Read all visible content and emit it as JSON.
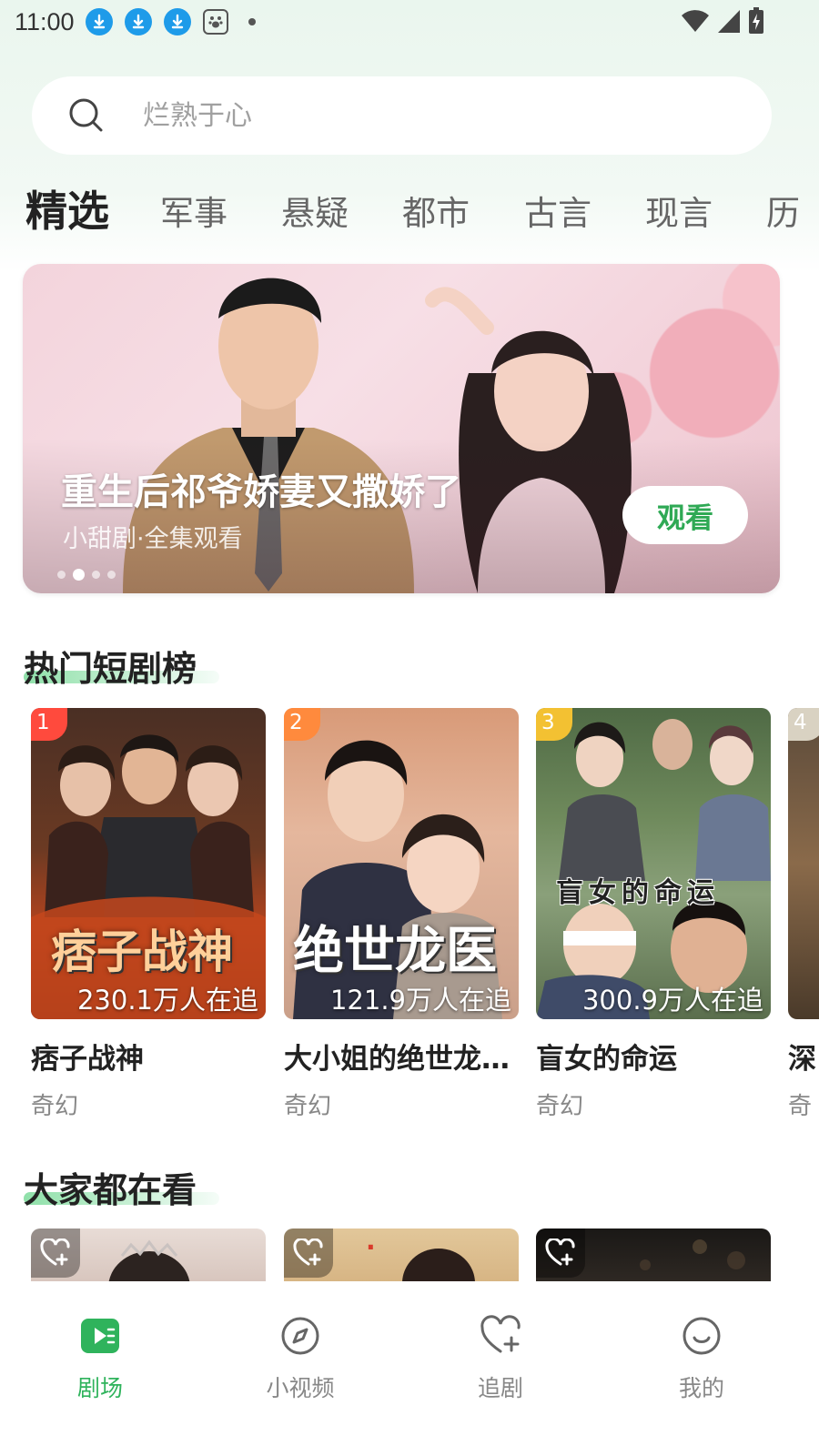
{
  "status_bar": {
    "time": "11:00"
  },
  "search": {
    "placeholder": "烂熟于心"
  },
  "tabs": [
    "精选",
    "军事",
    "悬疑",
    "都市",
    "古言",
    "现言",
    "历"
  ],
  "active_tab_index": 0,
  "banner": {
    "title": "重生后祁爷娇妻又撒娇了",
    "subtitle": "小甜剧·全集观看",
    "button_label": "观看",
    "dot_count": 4,
    "active_dot": 1
  },
  "hot_section": {
    "title": "热门短剧榜",
    "items": [
      {
        "rank": "1",
        "title": "痞子战神",
        "genre": "奇幻",
        "followers": "230.1万人在追",
        "poster_text": "痞子战神",
        "badge_color": "#ff4a3d"
      },
      {
        "rank": "2",
        "title": "大小姐的绝世龙…",
        "genre": "奇幻",
        "followers": "121.9万人在追",
        "poster_text": "绝世龙医",
        "badge_color": "#ff8a3d"
      },
      {
        "rank": "3",
        "title": "盲女的命运",
        "genre": "奇幻",
        "followers": "300.9万人在追",
        "poster_text": "盲女的命运",
        "badge_color": "#f3c132"
      },
      {
        "rank": "4",
        "title": "深",
        "genre": "奇"
      }
    ]
  },
  "watching_section": {
    "title": "大家都在看"
  },
  "bottom_nav": [
    {
      "label": "剧场",
      "icon": "theater-icon"
    },
    {
      "label": "小视频",
      "icon": "compass-icon"
    },
    {
      "label": "追剧",
      "icon": "heart-plus-icon"
    },
    {
      "label": "我的",
      "icon": "smile-icon"
    }
  ],
  "colors": {
    "accent_green": "#2fb35c",
    "badge_red": "#ff4a3d",
    "badge_orange": "#ff8a3d",
    "badge_yellow": "#f3c132"
  }
}
